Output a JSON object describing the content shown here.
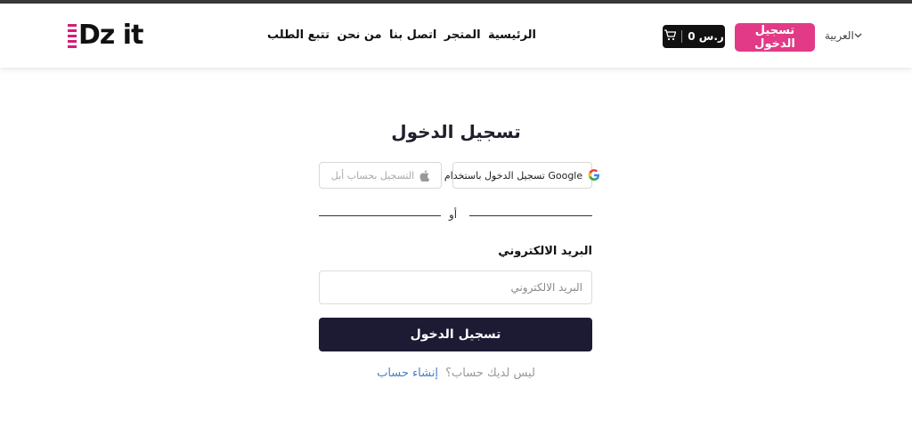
{
  "header": {
    "logo_text": "Dz it",
    "nav_items": [
      "الرئيسية",
      "المتجر",
      "اتصل بنا",
      "من نحن",
      "تتبع الطلب"
    ],
    "cart": {
      "amount": "ر.س 0",
      "icon": "cart-icon"
    },
    "login_button": "تسجيل الدخول",
    "language": "العربية",
    "accent_color": "#e23a86"
  },
  "login": {
    "title": "تسجيل الدخول",
    "google_label": "تسجيل الدخول باستخدام Google",
    "apple_label": "التسجيل بحساب أبل",
    "divider_text": "أو",
    "email_label": "البريد الالكتروني",
    "email_placeholder": "البريد الالكتروني",
    "submit_label": "تسجيل الدخول",
    "no_account_text": "ليس لديك حساب؟",
    "create_account_link": "إنشاء حساب",
    "button_color": "#1d1a33"
  }
}
